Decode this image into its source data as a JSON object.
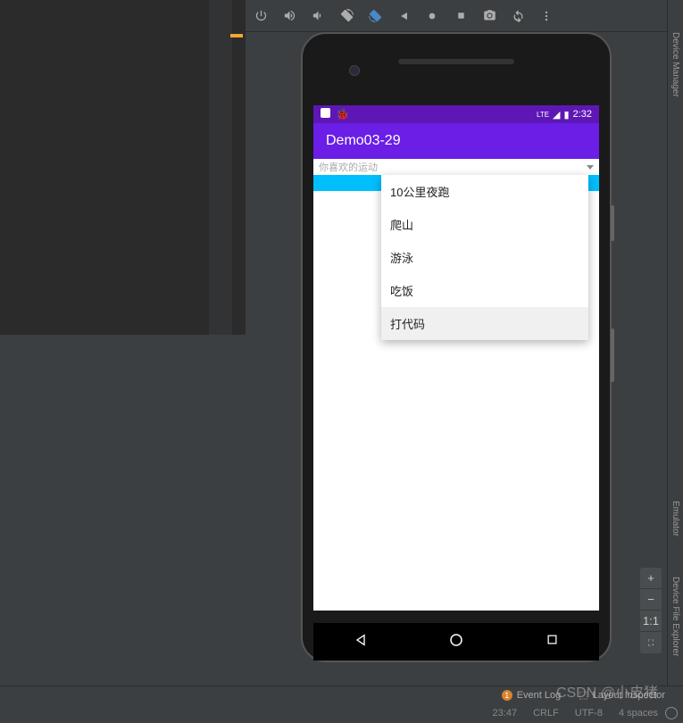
{
  "toolbar": {
    "tab_highlight": true
  },
  "phone": {
    "status": {
      "time": "2:32",
      "network": "LTE"
    },
    "app_title": "Demo03-29",
    "spinner_label": "你喜欢的运动",
    "dropdown_items": [
      "10公里夜跑",
      "爬山",
      "游泳",
      "吃饭",
      "打代码"
    ],
    "dropdown_hover_index": 4
  },
  "right_tabs": {
    "t1": "Device Manager",
    "t2": "Emulator",
    "t3": "Device File Explorer"
  },
  "zoom": {
    "plus": "+",
    "minus": "−",
    "one": "1:1",
    "fit": "⛶"
  },
  "bottom1": {
    "event_badge": "1",
    "event_log": "Event Log",
    "layout_inspector": "Layout Inspector"
  },
  "bottom2": {
    "pos": "23:47",
    "le": "CRLF",
    "enc": "UTF-8",
    "indent": "4 spaces"
  },
  "watermark": "CSDN @小皮猪"
}
